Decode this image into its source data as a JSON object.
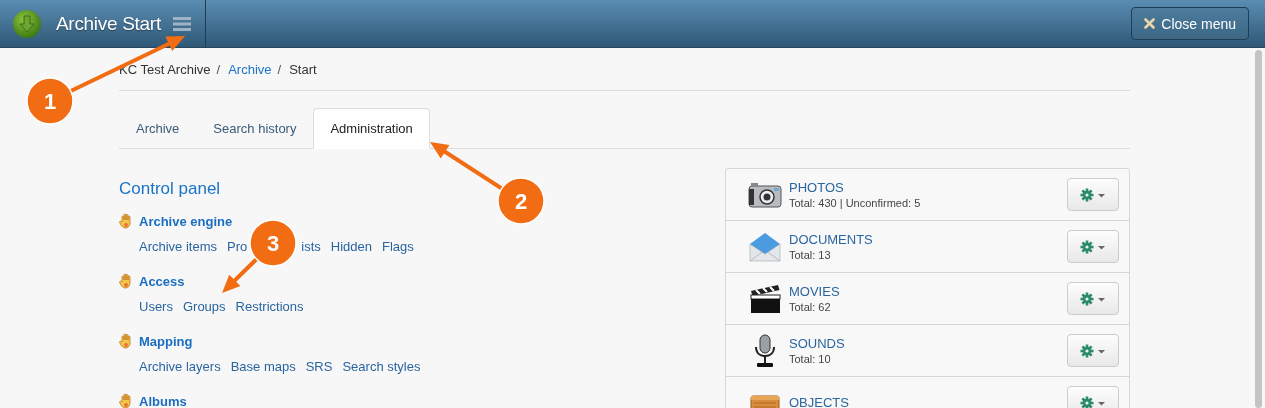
{
  "header": {
    "title": "Archive Start",
    "close_button": "Close menu"
  },
  "breadcrumb": [
    {
      "label": "KC Test Archive",
      "link": false,
      "separator": "/"
    },
    {
      "label": "Archive",
      "link": true,
      "separator": "/"
    },
    {
      "label": "Start",
      "link": false
    }
  ],
  "tabs": [
    {
      "label": "Archive",
      "selected": false
    },
    {
      "label": "Search history",
      "selected": false
    },
    {
      "label": "Administration",
      "selected": true
    }
  ],
  "control_panel": {
    "title": "Control panel",
    "sections": [
      {
        "title": "Archive engine",
        "links": [
          {
            "text": "Archive items"
          },
          {
            "text": "Pro"
          },
          {
            "text": "ists"
          },
          {
            "text": "Hidden"
          },
          {
            "text": "Flags"
          }
        ]
      },
      {
        "title": "Access",
        "links": [
          {
            "text": "Users"
          },
          {
            "text": "Groups"
          },
          {
            "text": "Restrictions"
          }
        ]
      },
      {
        "title": "Mapping",
        "links": [
          {
            "text": "Archive layers"
          },
          {
            "text": "Base maps"
          },
          {
            "text": "SRS"
          },
          {
            "text": "Search styles"
          }
        ]
      },
      {
        "title": "Albums"
      }
    ]
  },
  "collections": [
    {
      "kind": "camera",
      "name": "PHOTOS",
      "info": "Total: 430 | Unconfirmed: 5"
    },
    {
      "kind": "envelope",
      "name": "DOCUMENTS",
      "info": "Total: 13"
    },
    {
      "kind": "clapperboard",
      "name": "MOVIES",
      "info": "Total: 62"
    },
    {
      "kind": "microphone",
      "name": "SOUNDS",
      "info": "Total: 10"
    },
    {
      "kind": "crate",
      "name": "OBJECTS"
    }
  ],
  "callouts": [
    {
      "number": "1"
    },
    {
      "number": "2"
    },
    {
      "number": "3"
    }
  ]
}
